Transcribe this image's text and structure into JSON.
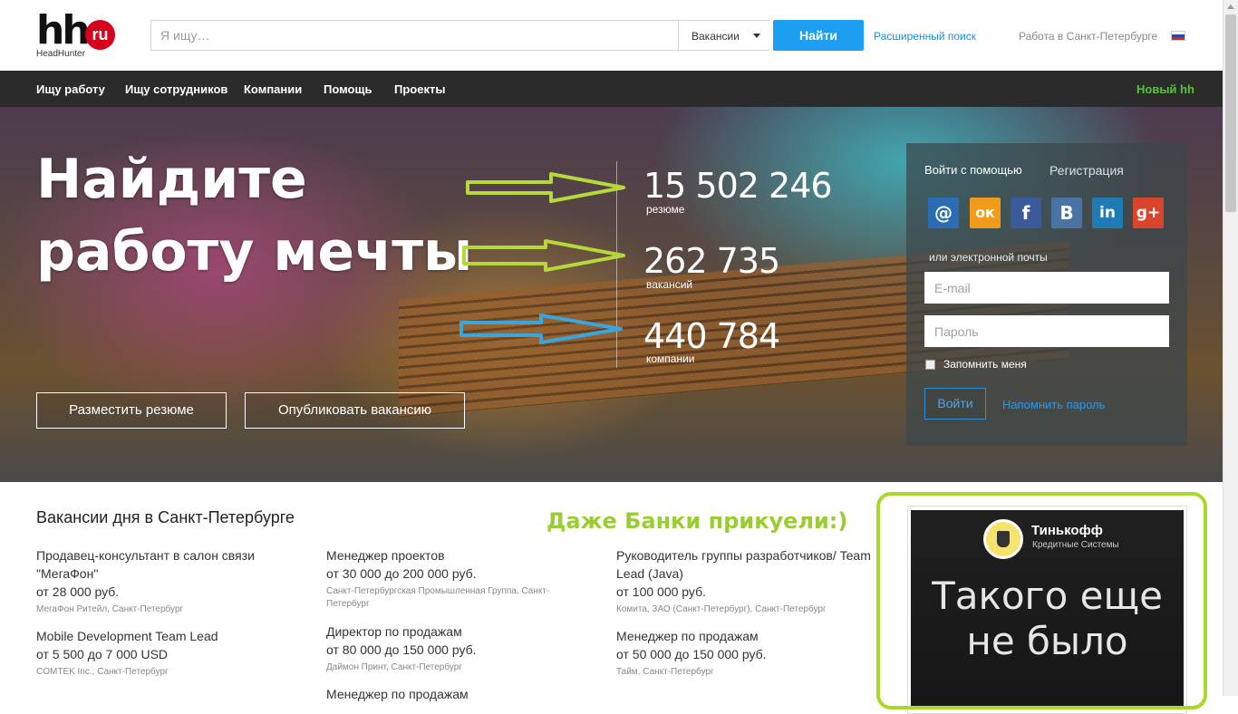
{
  "header": {
    "logo_text": "hh",
    "logo_badge": "ru",
    "logo_sub": "HeadHunter",
    "search_placeholder": "Я ищу…",
    "search_type": "Вакансии",
    "find_button": "Найти",
    "advanced_search": "Расширенный поиск",
    "region_link": "Работа в Санкт-Петербурге",
    "flag_icon": "russia-flag-icon"
  },
  "nav": {
    "items": [
      "Ищу работу",
      "Ищу сотрудников",
      "Компании",
      "Помощь",
      "Проекты"
    ],
    "new_hh": "Новый hh"
  },
  "hero": {
    "title": "Найдите работу мечты",
    "stats": [
      {
        "value": "15 502 246",
        "label": "резюме"
      },
      {
        "value": "262 735",
        "label": "вакансий"
      },
      {
        "value": "440 784",
        "label": "компании"
      }
    ],
    "buttons": [
      "Разместить резюме",
      "Опубликовать вакансию"
    ],
    "arrow_colors": [
      "#b5d93a",
      "#b5d93a",
      "#3aa6dc"
    ]
  },
  "login": {
    "tab_login": "Войти с помощью",
    "tab_register": "Регистрация",
    "social": [
      {
        "icon": "mail-icon",
        "glyph": "@",
        "color": "#2a6db5"
      },
      {
        "icon": "odnoklassniki-icon",
        "glyph": "ок",
        "color": "#f29a1a"
      },
      {
        "icon": "facebook-icon",
        "glyph": "f",
        "color": "#3b5a9a"
      },
      {
        "icon": "vkontakte-icon",
        "glyph": "В",
        "color": "#4a73a3"
      },
      {
        "icon": "linkedin-icon",
        "glyph": "in",
        "color": "#1e7bb4"
      },
      {
        "icon": "google-plus-icon",
        "glyph": "g+",
        "color": "#d9452b"
      }
    ],
    "or_email": "или электронной почты",
    "email_placeholder": "E-mail",
    "password_placeholder": "Пароль",
    "remember": "Запомнить меня",
    "login_button": "Войти",
    "forgot": "Напомнить пароль"
  },
  "vacancies": {
    "title": "Вакансии дня в Санкт-Петербурге",
    "items": [
      {
        "name": "Продавец-консультант в салон связи \"МегаФон\"",
        "salary": "от 28 000 руб.",
        "company": "МегаФон Ритейл, Санкт-Петербург"
      },
      {
        "name": "Mobile Development Team Lead",
        "salary": "от 5 500 до 7 000 USD",
        "company": "COMTEK Inc., Санкт-Петербург"
      },
      {
        "name": "Менеджер проектов",
        "salary": "от 30 000 до 200 000 руб.",
        "company": "Санкт-Петербургская Промышленная Группа, Санкт-Петербург"
      },
      {
        "name": "Директор по продажам",
        "salary": "от 80 000 до 150 000 руб.",
        "company": "Даймон Принт, Санкт-Петербург"
      },
      {
        "name": "Менеджер по продажам",
        "salary": "",
        "company": ""
      },
      {
        "name": "Руководитель группы разработчиков/ Team Lead (Java)",
        "salary": "от 100 000 руб.",
        "company": "Комита, ЗАО (Санкт-Петербург), Санкт-Петербург"
      },
      {
        "name": "Менеджер по продажам",
        "salary": "от 50 000 до 150 000 руб.",
        "company": "Тайм, Санкт-Петербург"
      }
    ]
  },
  "annotation": "Даже Банки прикуели:)",
  "ad": {
    "brand": "Тинькофф",
    "brand_sub": "Кредитные Системы",
    "text": "Такого еще не было"
  }
}
